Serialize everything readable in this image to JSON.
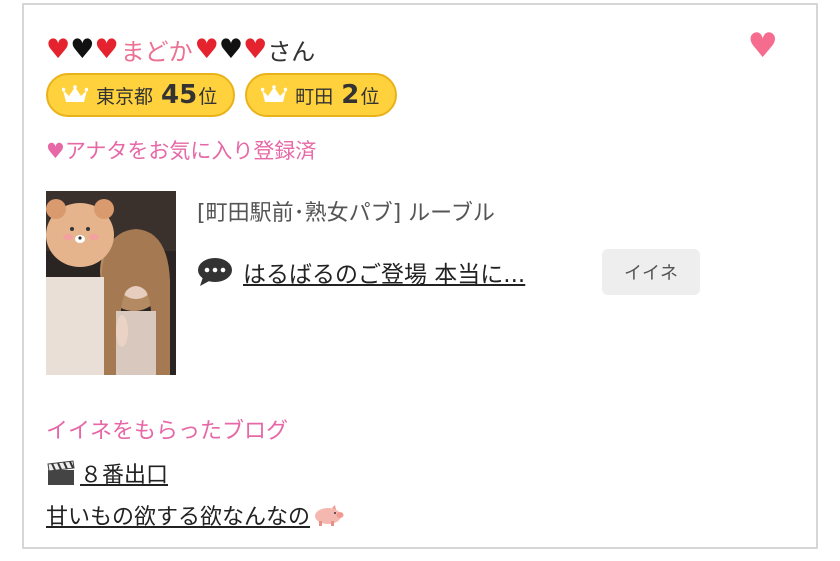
{
  "profile": {
    "name": "まどか",
    "name_suffix": "さん",
    "hearts": [
      "♥",
      "♥",
      "♥",
      "♥",
      "♥",
      "♥"
    ],
    "heart_colors": {
      "red": "#e5232f",
      "black": "#111111",
      "accent_pink": "#ec7192"
    }
  },
  "badges": [
    {
      "area": "東京都",
      "rank": "45",
      "unit": "位"
    },
    {
      "area": "町田",
      "rank": "2",
      "unit": "位"
    }
  ],
  "favorite_status": "♥アナタをお気に入り登録済",
  "shop": "[町田駅前･熟女パブ]  ルーブル",
  "post": {
    "title": "はるばるのご登場 本当に...",
    "like_label": "イイネ"
  },
  "liked_blogs": {
    "heading": "イイネをもらったブログ",
    "items": [
      {
        "text": "８番出口",
        "icon": "clapper-board-icon"
      },
      {
        "text": "甘いもの欲する欲なんなの",
        "icon": "pig-icon"
      }
    ]
  },
  "colors": {
    "badge_fill": "#ffd23d",
    "badge_border": "#eab21a",
    "pink_text": "#e668a6"
  }
}
